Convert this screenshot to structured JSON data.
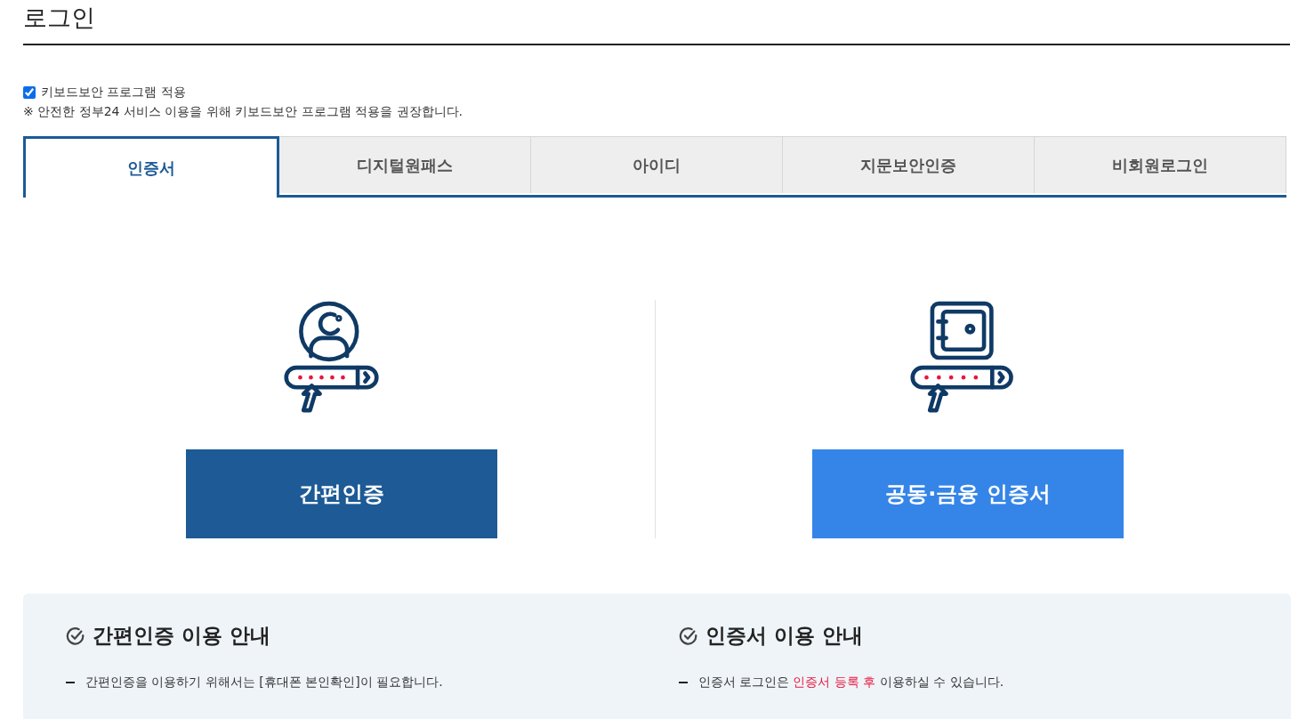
{
  "title": "로그인",
  "keyboard_security": {
    "label": "키보드보안 프로그램 적용",
    "checked": true
  },
  "notice": "※ 안전한 정부24 서비스 이용을 위해 키보드보안 프로그램 적용을 권장합니다.",
  "tabs": [
    {
      "label": "인증서",
      "selected": true
    },
    {
      "label": "디지털원패스",
      "selected": false
    },
    {
      "label": "아이디",
      "selected": false
    },
    {
      "label": "지문보안인증",
      "selected": false
    },
    {
      "label": "비회원로그인",
      "selected": false
    }
  ],
  "login_options": [
    {
      "kind": "simple",
      "button": "간편인증"
    },
    {
      "kind": "certificate",
      "button": "공동·금융 인증서"
    }
  ],
  "info_sections": [
    {
      "title": "간편인증 이용 안내",
      "items": [
        [
          {
            "text": "간편인증을 이용하기 위해서는 [휴대폰 본인확인]이 필요합니다.",
            "highlight": false
          }
        ]
      ]
    },
    {
      "title": "인증서 이용 안내",
      "items": [
        [
          {
            "text": "인증서 로그인은 ",
            "highlight": false
          },
          {
            "text": "인증서 등록 후",
            "highlight": true
          },
          {
            "text": " 이용하실 수 있습니다.",
            "highlight": false
          }
        ]
      ]
    }
  ]
}
